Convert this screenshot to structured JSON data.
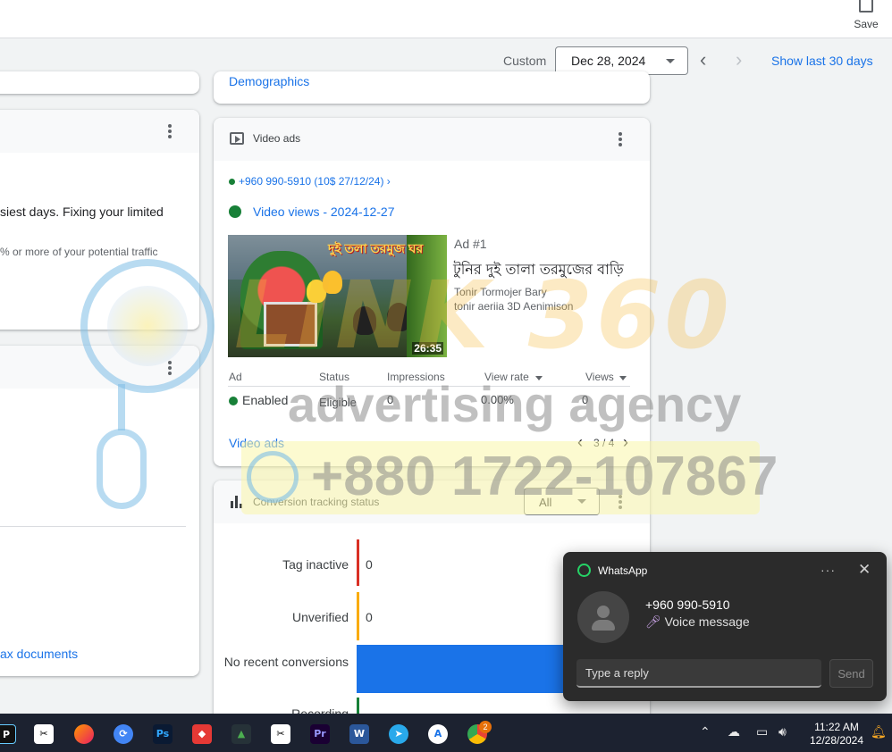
{
  "toolbar": {
    "save_label": "Save"
  },
  "datebar": {
    "custom_label": "Custom",
    "date_value": "Dec 28, 2024",
    "show_last_label": "Show last 30 days"
  },
  "left_cards": {
    "demographics_link": "Demographics",
    "insight_title": "siest days. Fixing your limited",
    "insight_sub": "% or more of your potential traffic",
    "tax_link": "ax documents"
  },
  "video_card": {
    "title": "Video ads",
    "campaign": "+960 990-5910 (10$ 27/12/24) ›",
    "adgroup": "Video views - 2024-12-27",
    "ad_number": "Ad #1",
    "ad_title": "টুনির দুই তালা তরমুজের বাড়ি",
    "channel": "Tonir Tormojer Bary",
    "channel_sub": "tonir aeriia 3D Aenimison",
    "thumb_overlay": "দুই তলা তরমুজ ঘর",
    "duration": "26:35",
    "columns": [
      "Ad",
      "Status",
      "Impressions",
      "View rate",
      "Views"
    ],
    "row": {
      "ad": "Enabled",
      "status": "Eligible",
      "impressions": "0",
      "view_rate": "0.00%",
      "views": "0"
    },
    "footer_link": "Video ads",
    "pager": "3 / 4"
  },
  "conversion_card": {
    "title": "Conversion tracking status",
    "filter": "All",
    "chart_data": {
      "type": "bar",
      "categories": [
        "Tag inactive",
        "Unverified",
        "No recent conversions",
        "Recording"
      ],
      "values": [
        0,
        0,
        null,
        null
      ],
      "value_labels": [
        "0",
        "0",
        "",
        ""
      ],
      "colors": [
        "#d93025",
        "#f9ab00",
        "#1a73e8",
        "#188038"
      ]
    }
  },
  "watermark": {
    "line1": "LINK 360",
    "line2": "advertising agency",
    "phone": "+880 1722-107867"
  },
  "notification": {
    "app": "WhatsApp",
    "sender": "+960 990-5910",
    "message": "Voice message",
    "reply_placeholder": "Type a reply",
    "send_label": "Send",
    "more": "···"
  },
  "taskbar": {
    "chrome_badge": "2",
    "time": "11:22 AM",
    "date": "12/28/2024"
  }
}
